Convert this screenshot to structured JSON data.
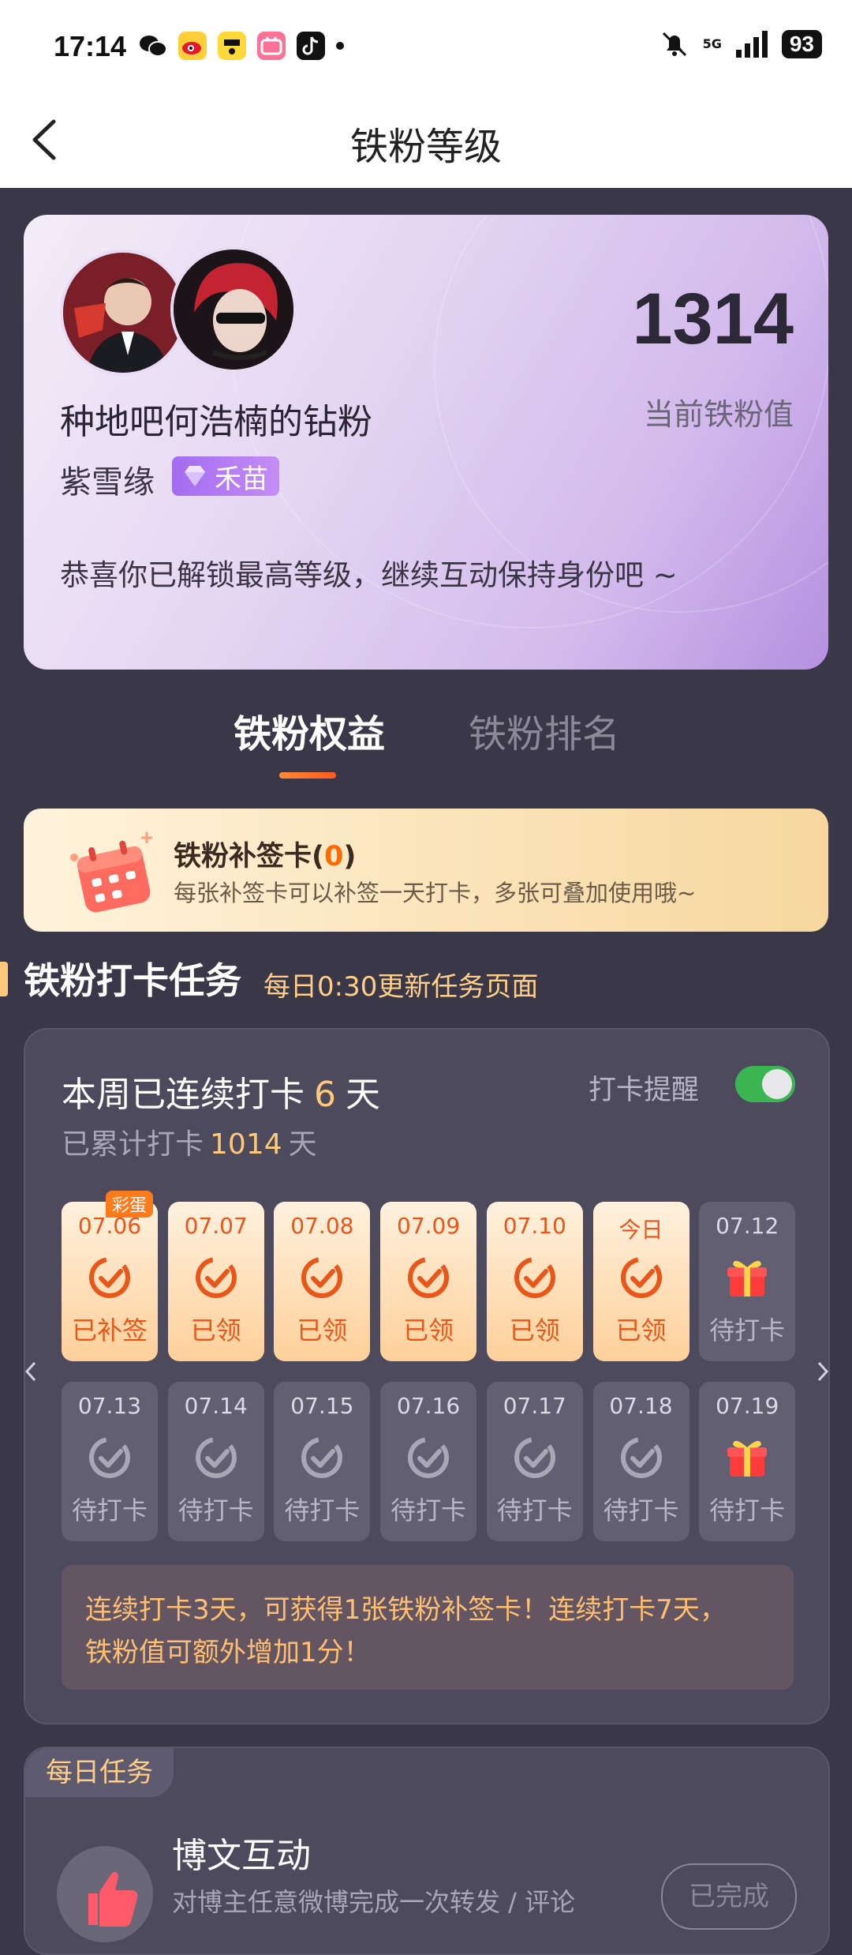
{
  "status_bar": {
    "time": "17:14",
    "apps": [
      {
        "name": "wechat-icon",
        "label": "",
        "bg": "#ffffff"
      },
      {
        "name": "weibo-icon",
        "label": "",
        "bg": "#ffce38"
      },
      {
        "name": "app-yellow-icon",
        "label": "",
        "bg": "#ffd93a"
      },
      {
        "name": "bilibili-icon",
        "label": "",
        "bg": "#fb7299"
      },
      {
        "name": "tiktok-icon",
        "label": "",
        "bg": "#111111"
      }
    ],
    "network": "5G",
    "battery": "93"
  },
  "header": {
    "title": "铁粉等级"
  },
  "hero": {
    "score": "1314",
    "score_label": "当前铁粉值",
    "fan_title": "种地吧何浩楠的钻粉",
    "fan_name": "紫雪缘",
    "badge_label": "禾苗",
    "congrats": "恭喜你已解锁最高等级，继续互动保持身份吧 ~"
  },
  "tabs": [
    {
      "label": "铁粉权益",
      "active": true
    },
    {
      "label": "铁粉排名",
      "active": false
    }
  ],
  "makeup_card": {
    "title_prefix": "铁粉补签卡(",
    "count": "0",
    "title_suffix": ")",
    "desc": "每张补签卡可以补签一天打卡，多张可叠加使用哦~"
  },
  "checkin": {
    "section_title": "铁粉打卡任务",
    "section_subtitle": "每日0:30更新任务页面",
    "week_prefix": "本周已连续打卡",
    "week_days": "6",
    "week_suffix": "天",
    "total_prefix": "已累计打卡",
    "total_days": "1014",
    "total_suffix": "天",
    "remind_label": "打卡提醒",
    "remind_on": true,
    "egg_label": "彩蛋",
    "days": [
      {
        "date": "07.06",
        "status": "已补签",
        "state": "done",
        "egg": true
      },
      {
        "date": "07.07",
        "status": "已领",
        "state": "done"
      },
      {
        "date": "07.08",
        "status": "已领",
        "state": "done"
      },
      {
        "date": "07.09",
        "status": "已领",
        "state": "done"
      },
      {
        "date": "07.10",
        "status": "已领",
        "state": "done"
      },
      {
        "date": "今日",
        "status": "已领",
        "state": "done"
      },
      {
        "date": "07.12",
        "status": "待打卡",
        "state": "gift"
      },
      {
        "date": "07.13",
        "status": "待打卡",
        "state": "pend"
      },
      {
        "date": "07.14",
        "status": "待打卡",
        "state": "pend"
      },
      {
        "date": "07.15",
        "status": "待打卡",
        "state": "pend"
      },
      {
        "date": "07.16",
        "status": "待打卡",
        "state": "pend"
      },
      {
        "date": "07.17",
        "status": "待打卡",
        "state": "pend"
      },
      {
        "date": "07.18",
        "status": "待打卡",
        "state": "pend"
      },
      {
        "date": "07.19",
        "status": "待打卡",
        "state": "gift"
      }
    ],
    "tip_line1": "连续打卡3天，可获得1张铁粉补签卡！连续打卡7天，",
    "tip_line2": "铁粉值可额外增加1分！"
  },
  "daily_task": {
    "tag": "每日任务",
    "title": "博文互动",
    "desc": "对博主任意微博完成一次转发 / 评论",
    "button": "已完成"
  },
  "colors": {
    "accent_orange": "#e8561a",
    "highlight": "#ffc87a",
    "toggle_on": "#3bb552",
    "badge_purple": "#a36cf0"
  }
}
